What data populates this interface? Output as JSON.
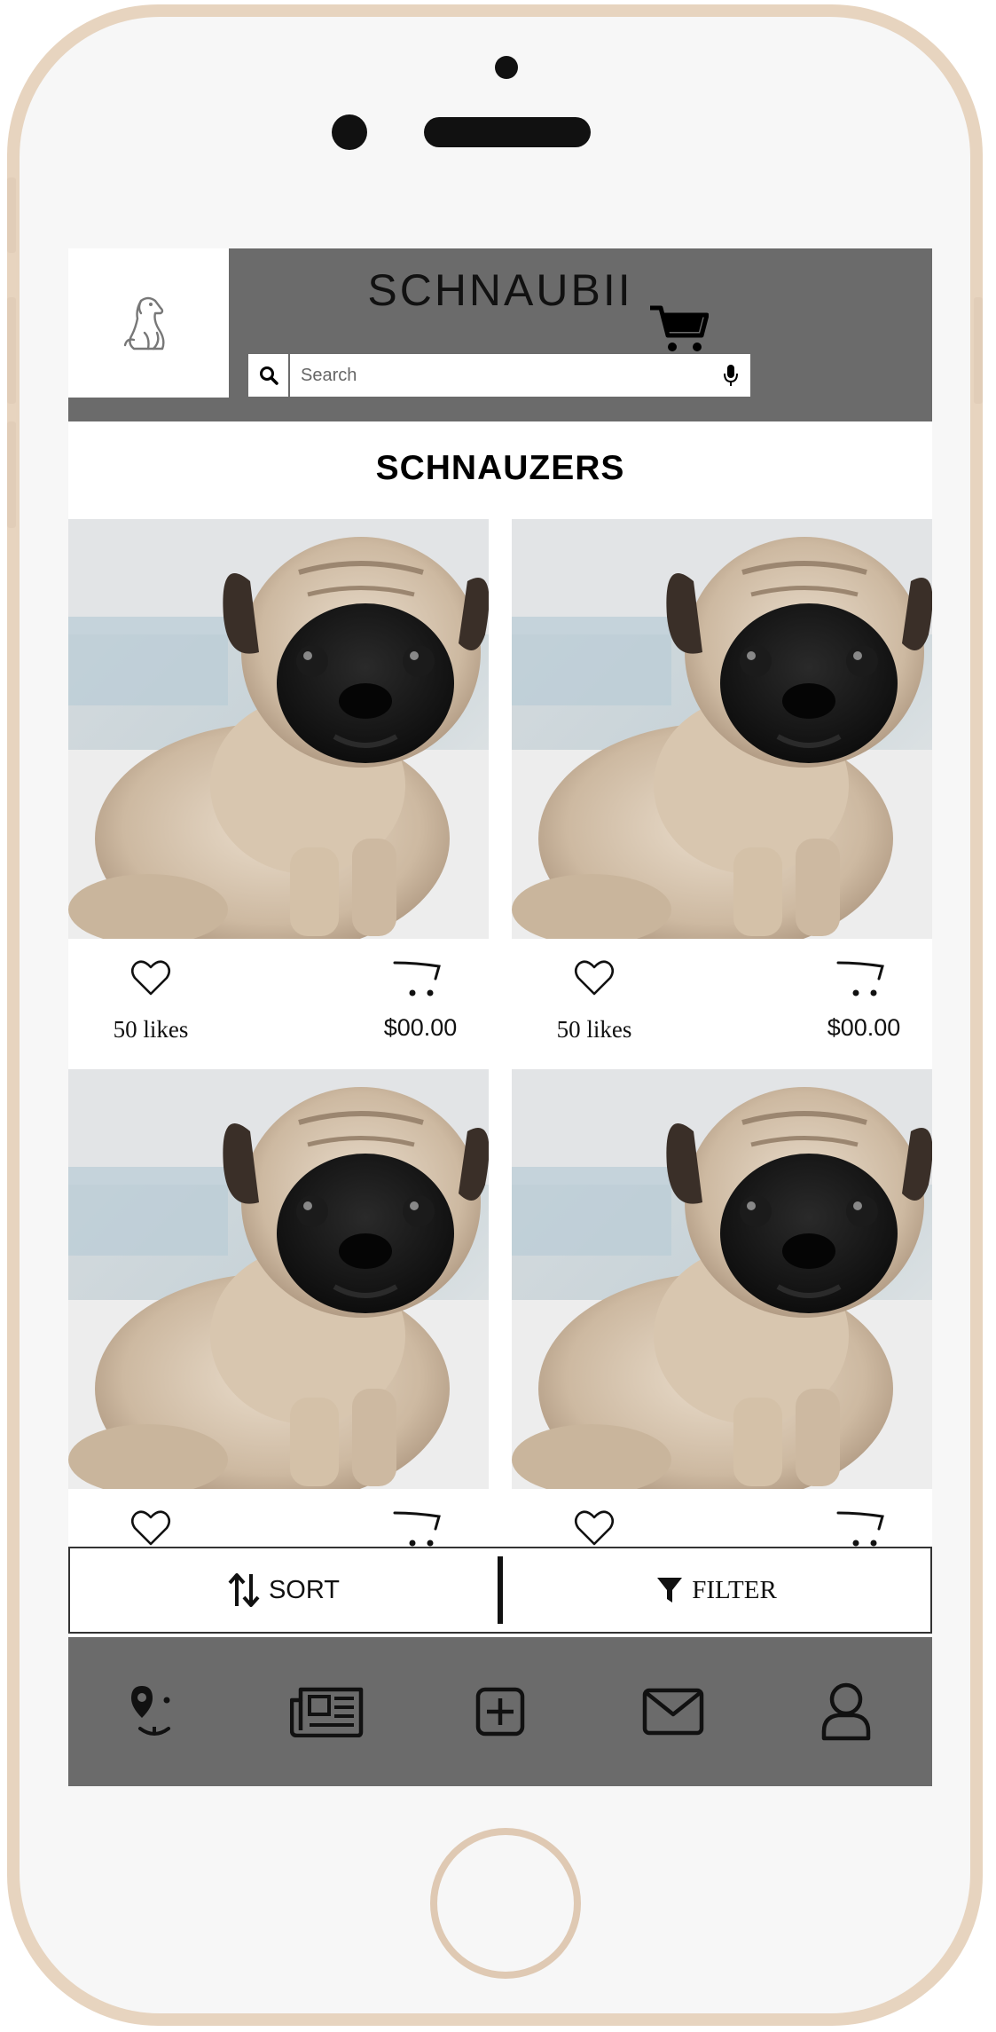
{
  "app": {
    "title": "SCHNAUBII",
    "logo_icon": "dog-sitting-icon"
  },
  "search": {
    "placeholder": "Search",
    "value": "",
    "search_icon": "search-icon",
    "mic_icon": "microphone-icon"
  },
  "header": {
    "cart_icon": "shopping-cart-icon"
  },
  "category": {
    "title": "SCHNAUZERS"
  },
  "products": [
    {
      "likes": "50 likes",
      "price": "$00.00",
      "image": "pug-puppy-photo"
    },
    {
      "likes": "50 likes",
      "price": "$00.00",
      "image": "pug-puppy-photo"
    },
    {
      "likes": "",
      "price": "",
      "image": "pug-puppy-photo"
    },
    {
      "likes": "",
      "price": "",
      "image": "pug-puppy-photo"
    }
  ],
  "toolbar": {
    "sort_label": "SORT",
    "filter_label": "FILTER",
    "sort_icon": "sort-arrows-icon",
    "filter_icon": "funnel-icon"
  },
  "bottom_nav": [
    {
      "id": "map",
      "icon": "dog-location-icon"
    },
    {
      "id": "news",
      "icon": "newspaper-icon"
    },
    {
      "id": "add",
      "icon": "add-square-icon"
    },
    {
      "id": "messages",
      "icon": "envelope-icon"
    },
    {
      "id": "profile",
      "icon": "user-icon"
    }
  ],
  "colors": {
    "header_bg": "#6b6b6b",
    "phone_frame": "#e7d4bf",
    "screen_bg": "#ffffff"
  }
}
